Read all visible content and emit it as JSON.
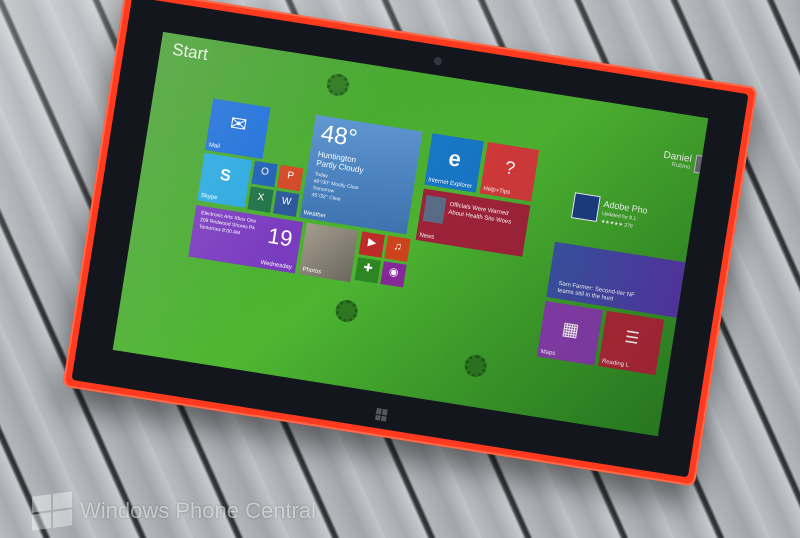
{
  "screen": {
    "title": "Start",
    "user": {
      "name": "Daniel",
      "subtitle": "Rubino"
    }
  },
  "tiles": {
    "mail": {
      "label": "Mail",
      "color": "#1e6fd9"
    },
    "skype": {
      "label": "Skype",
      "color": "#2aa9e0"
    },
    "outlook": {
      "color": "#1d5fb5"
    },
    "powerpoint": {
      "color": "#d24726"
    },
    "excel": {
      "color": "#1e7145"
    },
    "word": {
      "color": "#2b579a"
    },
    "weather": {
      "temp": "48°",
      "location": "Huntington",
      "condition": "Partly Cloudy",
      "today": "Today",
      "today_fc": "48°/30° Mostly Clear",
      "tomorrow": "Tomorrow",
      "tomorrow_fc": "45°/32° Clear",
      "label": "Weather",
      "color": "#4b87c7"
    },
    "ie": {
      "label": "Internet Explorer",
      "color": "#1979ca"
    },
    "help": {
      "label": "Help+Tips",
      "color": "#d63b3b"
    },
    "calendar": {
      "line1": "Electronic Arts Xbox One",
      "line2": "209 Redwood Shores Pk",
      "line3": "Tomorrow 8:00 AM",
      "day": "19",
      "day_name": "Wednesday",
      "color": "#7a3bbf"
    },
    "photos": {
      "label": "Photos",
      "color": "#8c8579"
    },
    "video": {
      "color": "#c32b2b"
    },
    "music": {
      "color": "#d4461d"
    },
    "games": {
      "color": "#2f8a24"
    },
    "camera": {
      "color": "#8b2a9e"
    },
    "news": {
      "headline_1": "Officials Were Warned",
      "headline_2": "About Health Site Woes",
      "label": "News",
      "color": "#a3243c"
    },
    "app": {
      "name": "Adobe Pho",
      "sub": "Updated for 8.1",
      "rating": "★★★★★ 279",
      "color": "#1d3f86"
    },
    "sports": {
      "line1": "Sam Farmer: Second-tier NF",
      "line2": "teams still in the hunt",
      "color": "#5a3ab0"
    },
    "maps": {
      "label": "Maps",
      "color": "#8a3fb0"
    },
    "reading": {
      "label": "Reading L",
      "color": "#b42a3a"
    }
  },
  "watermark": {
    "text": "Windows Phone Central"
  }
}
